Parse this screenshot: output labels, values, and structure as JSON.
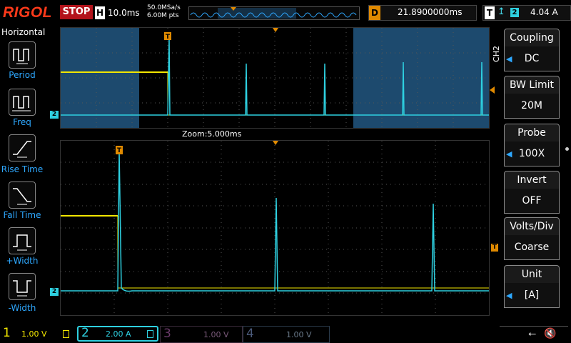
{
  "brand": "RIGOL",
  "run_state": "STOP",
  "timebase": {
    "key": "H",
    "value": "10.0ms"
  },
  "acquisition": {
    "rate": "50.0MSa/s",
    "points": "6.00M pts"
  },
  "delay": {
    "key": "D",
    "value": "21.8900000ms"
  },
  "trigger": {
    "key": "T",
    "source": "2",
    "level": "4.04 A"
  },
  "zoom_label": "Zoom:5.000ms",
  "left_menu": {
    "title": "Horizontal",
    "items": [
      "Period",
      "Freq",
      "Rise Time",
      "Fall Time",
      "+Width",
      "-Width"
    ]
  },
  "right_menu": {
    "channel_tag": "CH2",
    "items": [
      {
        "title": "Coupling",
        "value": "DC",
        "adjustable": true
      },
      {
        "title": "BW Limit",
        "value": "20M",
        "adjustable": false
      },
      {
        "title": "Probe",
        "value": "100X",
        "adjustable": true
      },
      {
        "title": "Invert",
        "value": "OFF",
        "adjustable": false
      },
      {
        "title": "Volts/Div",
        "value": "Coarse",
        "adjustable": false
      },
      {
        "title": "Unit",
        "value": "[A]",
        "adjustable": true
      }
    ]
  },
  "channels": [
    {
      "num": "1",
      "scale": "1.00 V",
      "color": "#f2e600",
      "active": true
    },
    {
      "num": "2",
      "scale": "2.00 A",
      "color": "#2ed0e0",
      "active": true
    },
    {
      "num": "3",
      "scale": "1.00 V",
      "color": "#c040c0",
      "active": false
    },
    {
      "num": "4",
      "scale": "1.00 V",
      "color": "#3a7ad8",
      "active": false
    }
  ],
  "markers": {
    "ch2": "2",
    "trigger": "T"
  },
  "colors": {
    "ch1": "#f2e600",
    "ch2": "#2ed0e0",
    "accent": "#e08a00",
    "menu_blue": "#2ea8ff",
    "stop_red": "#b3131b"
  }
}
